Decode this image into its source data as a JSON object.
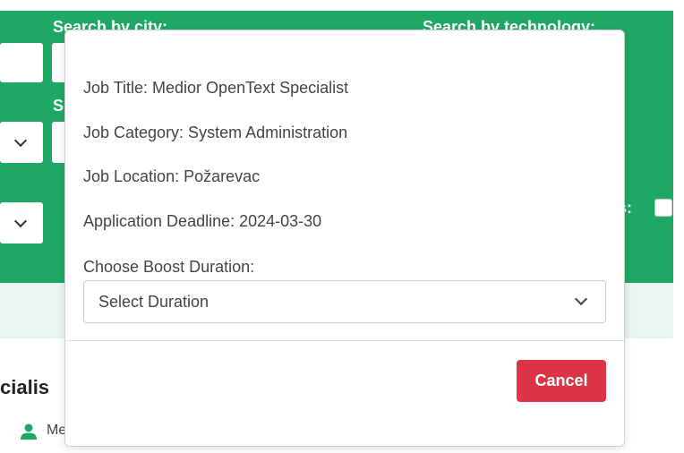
{
  "background": {
    "search_city_label": "Search by city:",
    "search_tech_label": "Search by technology:",
    "second_label_fragment": "S",
    "checkbox_label_fragment": "s:",
    "job_card_title_fragment": "cialis",
    "job_card_meta_fragment": "Me"
  },
  "modal": {
    "job_title": "Job Title: Medior OpenText Specialist",
    "job_category": "Job Category: System Administration",
    "job_location": "Job Location: Požarevac",
    "application_deadline": "Application Deadline: 2024-03-30",
    "boost_label": "Choose Boost Duration:",
    "boost_select_value": "Select Duration",
    "cancel_label": "Cancel"
  },
  "colors": {
    "primary_green": "#1fa865",
    "danger_red": "#dc3545"
  }
}
